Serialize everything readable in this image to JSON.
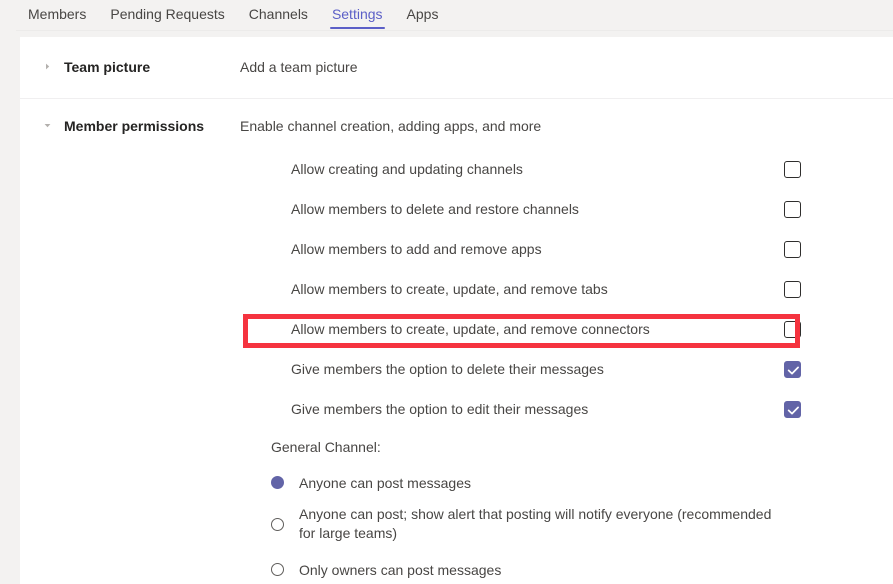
{
  "tabs": [
    {
      "label": "Members",
      "active": false
    },
    {
      "label": "Pending Requests",
      "active": false
    },
    {
      "label": "Channels",
      "active": false
    },
    {
      "label": "Settings",
      "active": true
    },
    {
      "label": "Apps",
      "active": false
    }
  ],
  "sections": {
    "team_picture": {
      "title": "Team picture",
      "description": "Add a team picture",
      "expanded": false,
      "chevron_icon": "chevron-right-icon"
    },
    "member_permissions": {
      "title": "Member permissions",
      "description": "Enable channel creation, adding apps, and more",
      "expanded": true,
      "chevron_icon": "chevron-down-icon"
    }
  },
  "permissions": [
    {
      "label": "Allow creating and updating channels",
      "checked": false
    },
    {
      "label": "Allow members to delete and restore channels",
      "checked": false
    },
    {
      "label": "Allow members to add and remove apps",
      "checked": false
    },
    {
      "label": "Allow members to create, update, and remove tabs",
      "checked": false
    },
    {
      "label": "Allow members to create, update, and remove connectors",
      "checked": false
    },
    {
      "label": "Give members the option to delete their messages",
      "checked": true
    },
    {
      "label": "Give members the option to edit their messages",
      "checked": true
    }
  ],
  "general_channel": {
    "label": "General Channel:",
    "options": [
      {
        "label": "Anyone can post messages",
        "selected": true
      },
      {
        "label": "Anyone can post; show alert that posting will notify everyone (recommended for large teams)",
        "selected": false
      },
      {
        "label": "Only owners can post messages",
        "selected": false
      }
    ]
  },
  "annotation": {
    "target_label": "Allow members to create, update, and remove connectors",
    "color": "#f5333f"
  },
  "colors": {
    "accent": "#6264a7",
    "tab_active": "#5b5fc7",
    "text": "#484644",
    "heading": "#252423",
    "page_background": "#f3f2f1",
    "card_background": "#ffffff"
  }
}
